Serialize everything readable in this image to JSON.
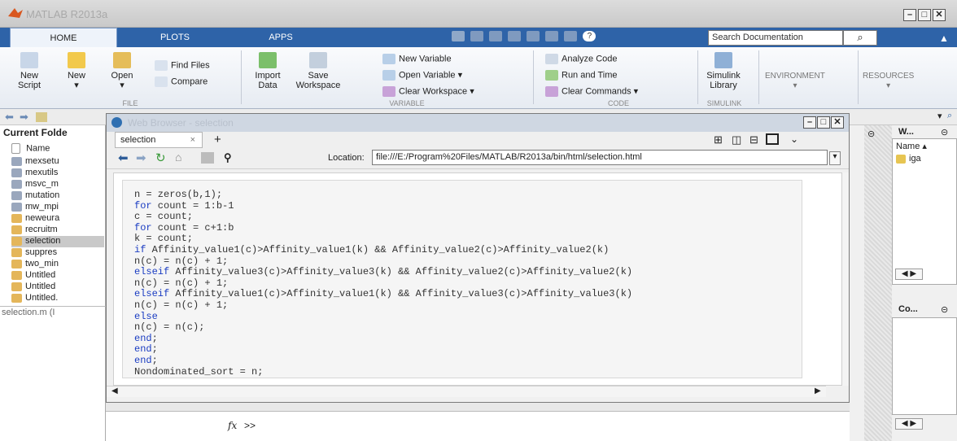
{
  "app": {
    "title": "MATLAB R2013a"
  },
  "ribbon_tabs": [
    "HOME",
    "PLOTS",
    "APPS"
  ],
  "search": {
    "placeholder": "Search Documentation"
  },
  "ribbon": {
    "new_script": "New\nScript",
    "new": "New",
    "open": "Open",
    "find_files": "Find Files",
    "compare": "Compare",
    "import_data": "Import\nData",
    "save_workspace": "Save\nWorkspace",
    "new_variable": "New Variable",
    "open_variable": "Open Variable ▾",
    "clear_workspace": "Clear Workspace ▾",
    "analyze_code": "Analyze Code",
    "run_and_time": "Run and Time",
    "clear_commands": "Clear Commands ▾",
    "simulink_library": "Simulink\nLibrary",
    "environment": "ENVIRONMENT",
    "resources": "RESOURCES",
    "sections": [
      "FILE",
      "VARIABLE",
      "CODE",
      "SIMULINK"
    ]
  },
  "current_folder": {
    "title": "Current Folde",
    "column": "Name",
    "items": [
      "mexsetu",
      "mexutils",
      "msvc_m",
      "mutation",
      "mw_mpi",
      "neweura",
      "recruitm",
      "selection",
      "suppres",
      "two_min",
      "Untitled",
      "Untitled",
      "Untitled."
    ],
    "selected_index": 7,
    "status": "selection.m (I"
  },
  "browser": {
    "window_title": "Web Browser - selection",
    "tab_label": "selection",
    "tab_close": "×",
    "new_tab": "+",
    "location_label": "Location:",
    "location_url": "file:///E:/Program%20Files/MATLAB/R2013a/bin/html/selection.html"
  },
  "code": [
    {
      "text": "n = zeros(b,1);",
      "kw": false
    },
    {
      "text": "for count = 1:b-1",
      "kw": true
    },
    {
      "text": "c = count;",
      "kw": false
    },
    {
      "text": "for count = c+1:b",
      "kw": true
    },
    {
      "text": "k = count;",
      "kw": false
    },
    {
      "text": "if Affinity_value1(c)>Affinity_value1(k) && Affinity_value2(c)>Affinity_value2(k)",
      "kw": true
    },
    {
      "text": "n(c) = n(c) + 1;",
      "kw": false
    },
    {
      "text": "elseif Affinity_value3(c)>Affinity_value3(k) && Affinity_value2(c)>Affinity_value2(k)",
      "kw": true
    },
    {
      "text": "n(c) = n(c) + 1;",
      "kw": false
    },
    {
      "text": "elseif Affinity_value1(c)>Affinity_value1(k) && Affinity_value3(c)>Affinity_value3(k)",
      "kw": true
    },
    {
      "text": "n(c) = n(c) + 1;",
      "kw": false
    },
    {
      "text": "else",
      "kw": true
    },
    {
      "text": "n(c) = n(c);",
      "kw": false
    },
    {
      "text": "end;",
      "kw": true
    },
    {
      "text": "end;",
      "kw": true
    },
    {
      "text": "end;",
      "kw": true
    },
    {
      "text": "Nondominated_sort = n;",
      "kw": false
    }
  ],
  "command": {
    "fx": "fx",
    "prompt": ">>"
  },
  "workspace": {
    "title": "W...",
    "column": "Name",
    "item": "iga"
  },
  "command_history": {
    "title": "Co..."
  },
  "colors": {
    "ribbon_tab_bar": "#2e63a8",
    "keyword": "#1a3cc2"
  }
}
